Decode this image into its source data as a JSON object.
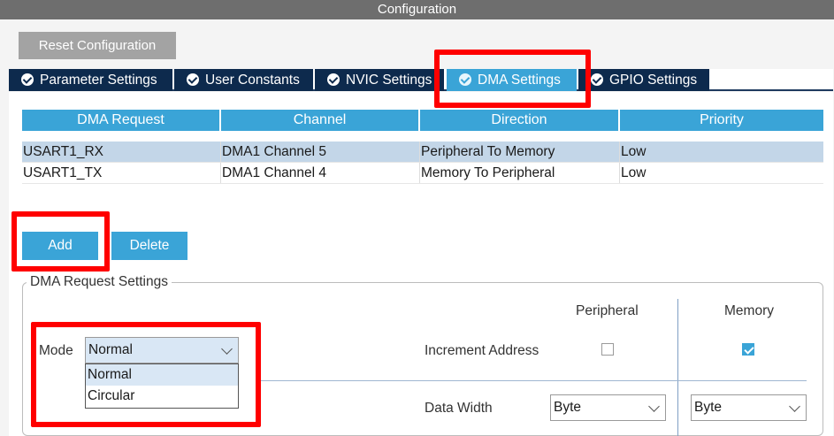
{
  "window": {
    "title": "Configuration"
  },
  "toolbar": {
    "reset_label": "Reset Configuration"
  },
  "tabs": [
    {
      "label": "Parameter Settings"
    },
    {
      "label": "User Constants"
    },
    {
      "label": "NVIC Settings"
    },
    {
      "label": "DMA Settings"
    },
    {
      "label": "GPIO Settings"
    }
  ],
  "active_tab": "DMA Settings",
  "dma_table": {
    "headers": [
      "DMA Request",
      "Channel",
      "Direction",
      "Priority"
    ],
    "rows": [
      [
        "USART1_RX",
        "DMA1 Channel 5",
        "Peripheral To Memory",
        "Low"
      ],
      [
        "USART1_TX",
        "DMA1 Channel 4",
        "Memory To Peripheral",
        "Low"
      ]
    ],
    "selected_row": 0
  },
  "actions": {
    "add_label": "Add",
    "delete_label": "Delete"
  },
  "request_settings": {
    "legend": "DMA Request Settings",
    "peripheral_header": "Peripheral",
    "memory_header": "Memory",
    "mode_label": "Mode",
    "mode_value": "Normal",
    "mode_options": [
      "Normal",
      "Circular"
    ],
    "increment_label": "Increment Address",
    "peripheral_increment": false,
    "memory_increment": true,
    "data_width_label": "Data Width",
    "peripheral_width": "Byte",
    "memory_width": "Byte"
  },
  "colors": {
    "accent": "#3aa4d7",
    "tab_dark": "#0d2a4d",
    "highlight_box": "#ff0000",
    "selected_row": "#c3d6e8"
  }
}
